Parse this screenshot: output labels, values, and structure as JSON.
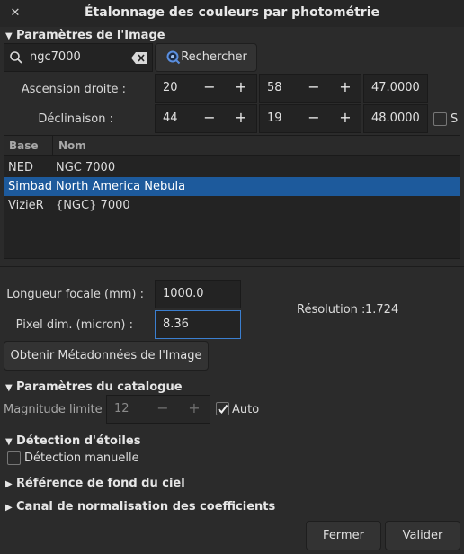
{
  "window": {
    "title": "Étalonnage des couleurs par photométrie",
    "close_glyph": "✕",
    "minimize_glyph": "—"
  },
  "image_params": {
    "section_label": "Paramètres de l'Image",
    "search_value": "ngc7000",
    "search_button": "Rechercher",
    "ra_label": "Ascension droite :",
    "ra_h": "20",
    "ra_m": "58",
    "ra_s": "47.0000",
    "dec_label": "Déclinaison :",
    "dec_d": "44",
    "dec_m": "19",
    "dec_s": "48.0000",
    "south_label": "S",
    "minus": "−",
    "plus": "+",
    "table": {
      "headers": [
        "Base",
        "Nom"
      ],
      "rows": [
        {
          "base": "NED",
          "name": "NGC 7000"
        },
        {
          "base": "Simbad",
          "name": "North America Nebula"
        },
        {
          "base": "VizieR",
          "name": "{NGC} 7000"
        }
      ],
      "selected_index": 1
    },
    "focal_label": "Longueur focale (mm) :",
    "focal_value": "1000.0",
    "pixel_label": "Pixel dim. (micron) :",
    "pixel_value": "8.36",
    "resolution_label": "Résolution :",
    "resolution_value": "1.724",
    "metadata_button": "Obtenir Métadonnées de l'Image"
  },
  "catalog": {
    "section_label": "Paramètres du catalogue",
    "mag_label": "Magnitude limite :",
    "mag_value": "12",
    "auto_label": "Auto",
    "auto_checked": true
  },
  "star_detection": {
    "section_label": "Détection d'étoiles",
    "manual_label": "Détection manuelle",
    "manual_checked": false
  },
  "sky_background": {
    "section_label": "Référence de fond du ciel"
  },
  "normalization": {
    "section_label": "Canal de normalisation des coefficients"
  },
  "footer": {
    "close_button": "Fermer",
    "ok_button": "Valider"
  },
  "colors": {
    "selection": "#1d5a9c",
    "focus_border": "#3b7fd0",
    "background": "#2b2b2b"
  }
}
